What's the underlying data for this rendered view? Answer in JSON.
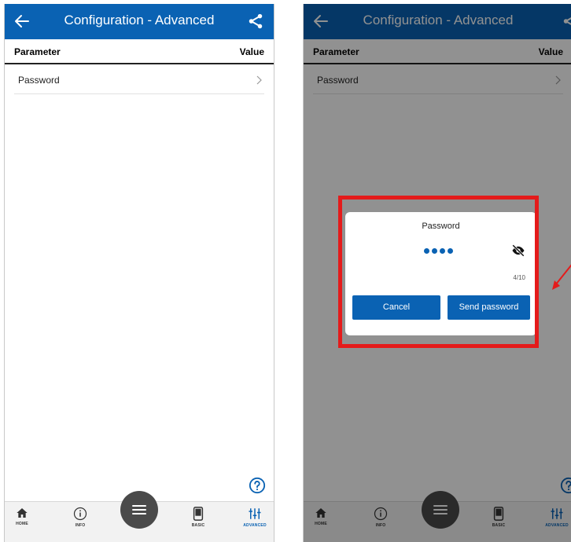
{
  "colors": {
    "primary": "#0a62b3",
    "highlight": "#e41b1b",
    "fab": "#4a4a4a"
  },
  "app_bar": {
    "title": "Configuration - Advanced",
    "back_icon": "arrow-left-icon",
    "share_icon": "share-icon"
  },
  "table": {
    "header_parameter": "Parameter",
    "header_value": "Value"
  },
  "rows": [
    {
      "label": "Password",
      "icon": "chevron-right-icon"
    }
  ],
  "nav": {
    "home": "HOME",
    "info": "INFO",
    "menu_icon": "menu-icon",
    "basic": "BASIC",
    "advanced": "ADVANCED",
    "active": "ADVANCED"
  },
  "dialog": {
    "title": "Password",
    "masked_length": 4,
    "counter": "4/10",
    "cancel_label": "Cancel",
    "send_label": "Send password",
    "visibility_icon": "eye-off-icon"
  }
}
